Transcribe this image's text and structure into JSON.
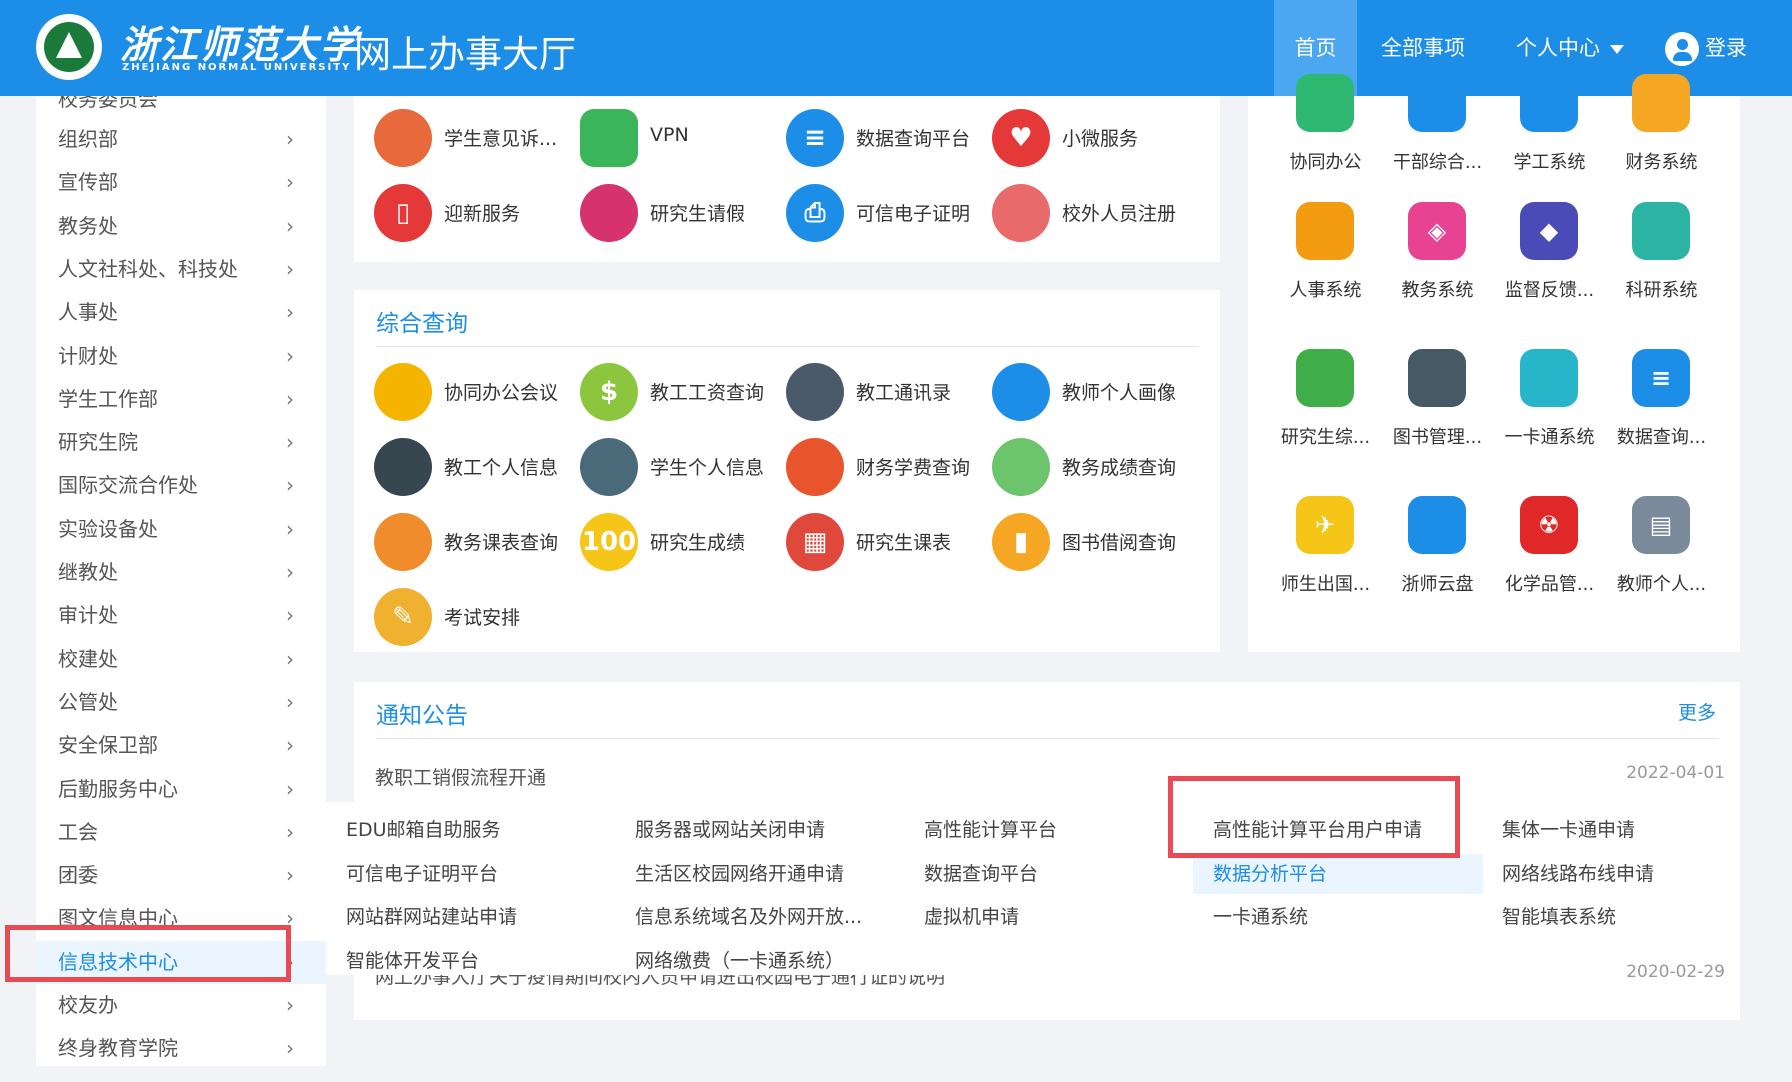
{
  "header": {
    "university_cn": "浙江师范大学",
    "university_en": "ZHEJIANG NORMAL UNIVERSITY",
    "app_title": "网上办事大厅",
    "nav": {
      "home": "首页",
      "all": "全部事项",
      "personal": "个人中心",
      "login": "登录"
    }
  },
  "sidebar": {
    "cut_top": "校务委员会",
    "items": [
      "组织部",
      "宣传部",
      "教务处",
      "人文社科处、科技处",
      "人事处",
      "计财处",
      "学生工作部",
      "研究生院",
      "国际交流合作处",
      "实验设备处",
      "继教处",
      "审计处",
      "校建处",
      "公管处",
      "安全保卫部",
      "后勤服务中心",
      "工会",
      "团委",
      "图文信息中心",
      "信息技术中心",
      "校友办",
      "终身教育学院"
    ],
    "active": "信息技术中心"
  },
  "top_apps": [
    {
      "label": "学生意见诉...",
      "icon": "person-complaint-icon",
      "color": "#e86a3c"
    },
    {
      "label": "VPN",
      "icon": "bank-icon",
      "color": "#3bb55a"
    },
    {
      "label": "数据查询平台",
      "icon": "database-icon",
      "color": "#1c8ee8"
    },
    {
      "label": "小微服务",
      "icon": "heart-hand-icon",
      "color": "#e53939"
    },
    {
      "label": "迎新服务",
      "icon": "suitcase-icon",
      "color": "#e53939"
    },
    {
      "label": "研究生请假",
      "icon": "person-clock-icon",
      "color": "#d6336c"
    },
    {
      "label": "可信电子证明",
      "icon": "printer-icon",
      "color": "#1c8ee8"
    },
    {
      "label": "校外人员注册",
      "icon": "register-icon",
      "color": "#e86a6a"
    }
  ],
  "query": {
    "title": "综合查询",
    "apps": [
      {
        "label": "协同办公会议",
        "icon": "meeting-icon",
        "color": "#f5b400"
      },
      {
        "label": "教工工资查询",
        "icon": "dollar-icon",
        "color": "#8cc63f"
      },
      {
        "label": "教工通讯录",
        "icon": "contacts-icon",
        "color": "#4a5a6a"
      },
      {
        "label": "教师个人画像",
        "icon": "teacher-profile-icon",
        "color": "#1c8ee8"
      },
      {
        "label": "教工个人信息",
        "icon": "id-card-icon",
        "color": "#37474f"
      },
      {
        "label": "学生个人信息",
        "icon": "student-info-icon",
        "color": "#4a6a7a"
      },
      {
        "label": "财务学费查询",
        "icon": "money-hand-icon",
        "color": "#e8542c"
      },
      {
        "label": "教务成绩查询",
        "icon": "student-grade-icon",
        "color": "#6cc56c"
      },
      {
        "label": "教务课表查询",
        "icon": "schedule-icon",
        "color": "#f08c2c"
      },
      {
        "label": "研究生成绩",
        "icon": "score-100-icon",
        "color": "#f5c518"
      },
      {
        "label": "研究生课表",
        "icon": "calendar-icon",
        "color": "#e0483c"
      },
      {
        "label": "图书借阅查询",
        "icon": "books-icon",
        "color": "#f5a623"
      },
      {
        "label": "考试安排",
        "icon": "exam-icon",
        "color": "#f0b030"
      }
    ]
  },
  "systems": [
    {
      "label": "协同办公",
      "icon": "office-icon",
      "color": "#2eb872"
    },
    {
      "label": "干部综合...",
      "icon": "cadre-icon",
      "color": "#1c8ee8"
    },
    {
      "label": "学工系统",
      "icon": "student-affairs-icon",
      "color": "#1c8ee8"
    },
    {
      "label": "财务系统",
      "icon": "finance-icon",
      "color": "#f5a623"
    },
    {
      "label": "人事系统",
      "icon": "personnel-icon",
      "color": "#f39c12"
    },
    {
      "label": "教务系统",
      "icon": "layers-icon",
      "color": "#e84393"
    },
    {
      "label": "监督反馈...",
      "icon": "shield-icon",
      "color": "#4b4bb8"
    },
    {
      "label": "科研系统",
      "icon": "research-book-icon",
      "color": "#2bb3a3"
    },
    {
      "label": "研究生综...",
      "icon": "graduate-icon",
      "color": "#3fae49"
    },
    {
      "label": "图书管理...",
      "icon": "library-icon",
      "color": "#455a64"
    },
    {
      "label": "一卡通系统",
      "icon": "card-screen-icon",
      "color": "#26b5c9"
    },
    {
      "label": "数据查询...",
      "icon": "database-icon",
      "color": "#1c8ee8"
    },
    {
      "label": "师生出国...",
      "icon": "airplane-icon",
      "color": "#f5c518"
    },
    {
      "label": "浙师云盘",
      "icon": "cloud-disk-icon",
      "color": "#1c8ee8"
    },
    {
      "label": "化学品管...",
      "icon": "radiation-icon",
      "color": "#e02828"
    },
    {
      "label": "教师个人...",
      "icon": "document-icon",
      "color": "#7a8a9a"
    }
  ],
  "notice": {
    "title": "通知公告",
    "more": "更多",
    "rows": [
      {
        "text": "教职工销假流程开通",
        "date": "2022-04-01"
      },
      {
        "text": "网上办事大厅关于疫情期间校内人员申请进出校园电子通行证的说明",
        "date": "2020-02-29"
      }
    ]
  },
  "flyout": {
    "items": [
      [
        "EDU邮箱自助服务",
        "服务器或网站关闭申请",
        "高性能计算平台",
        "高性能计算平台用户申请",
        "集体一卡通申请"
      ],
      [
        "可信电子证明平台",
        "生活区校园网络开通申请",
        "数据查询平台",
        "数据分析平台",
        "网络线路布线申请"
      ],
      [
        "网站群网站建站申请",
        "信息系统域名及外网开放...",
        "虚拟机申请",
        "一卡通系统",
        "智能填表系统"
      ],
      [
        "智能体开发平台",
        "网络缴费（一卡通系统）"
      ]
    ],
    "active": "数据分析平台"
  }
}
